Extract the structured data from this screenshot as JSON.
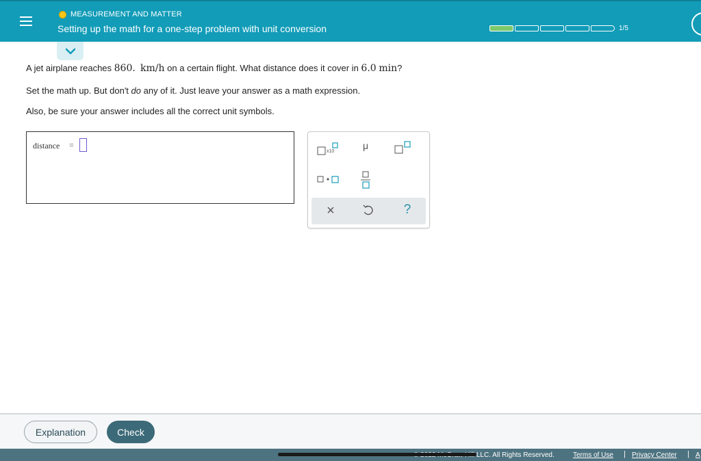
{
  "header": {
    "topic": "MEASUREMENT AND MATTER",
    "title": "Setting up the math for a one-step problem with unit conversion",
    "progress_text": "1/5",
    "progress": {
      "completed": 1,
      "total": 5
    },
    "accent_color": "#129cb8"
  },
  "question": {
    "line1_prefix": "A jet airplane reaches ",
    "speed_value": "860.",
    "speed_unit": "km/h",
    "line1_middle": " on a certain flight. What distance does it cover in ",
    "time_value": "6.0",
    "time_unit": "min",
    "line1_suffix": "?",
    "line2_prefix": "Set the math up. But don't ",
    "line2_emph": "do",
    "line2_suffix": " any of it. Just leave your answer as a math expression.",
    "line3": "Also, be sure your answer includes all the correct unit symbols."
  },
  "answer": {
    "label": "distance",
    "equals": "="
  },
  "palette": {
    "x10_label": "x10",
    "mu_label": "μ",
    "clear_symbol": "×",
    "help_symbol": "?"
  },
  "footer": {
    "explanation_label": "Explanation",
    "check_label": "Check",
    "copyright": "© 2022 McGraw Hill LLC. All Rights Reserved.",
    "terms_label": "Terms of Use",
    "privacy_label": "Privacy Center",
    "access_label": "A"
  }
}
